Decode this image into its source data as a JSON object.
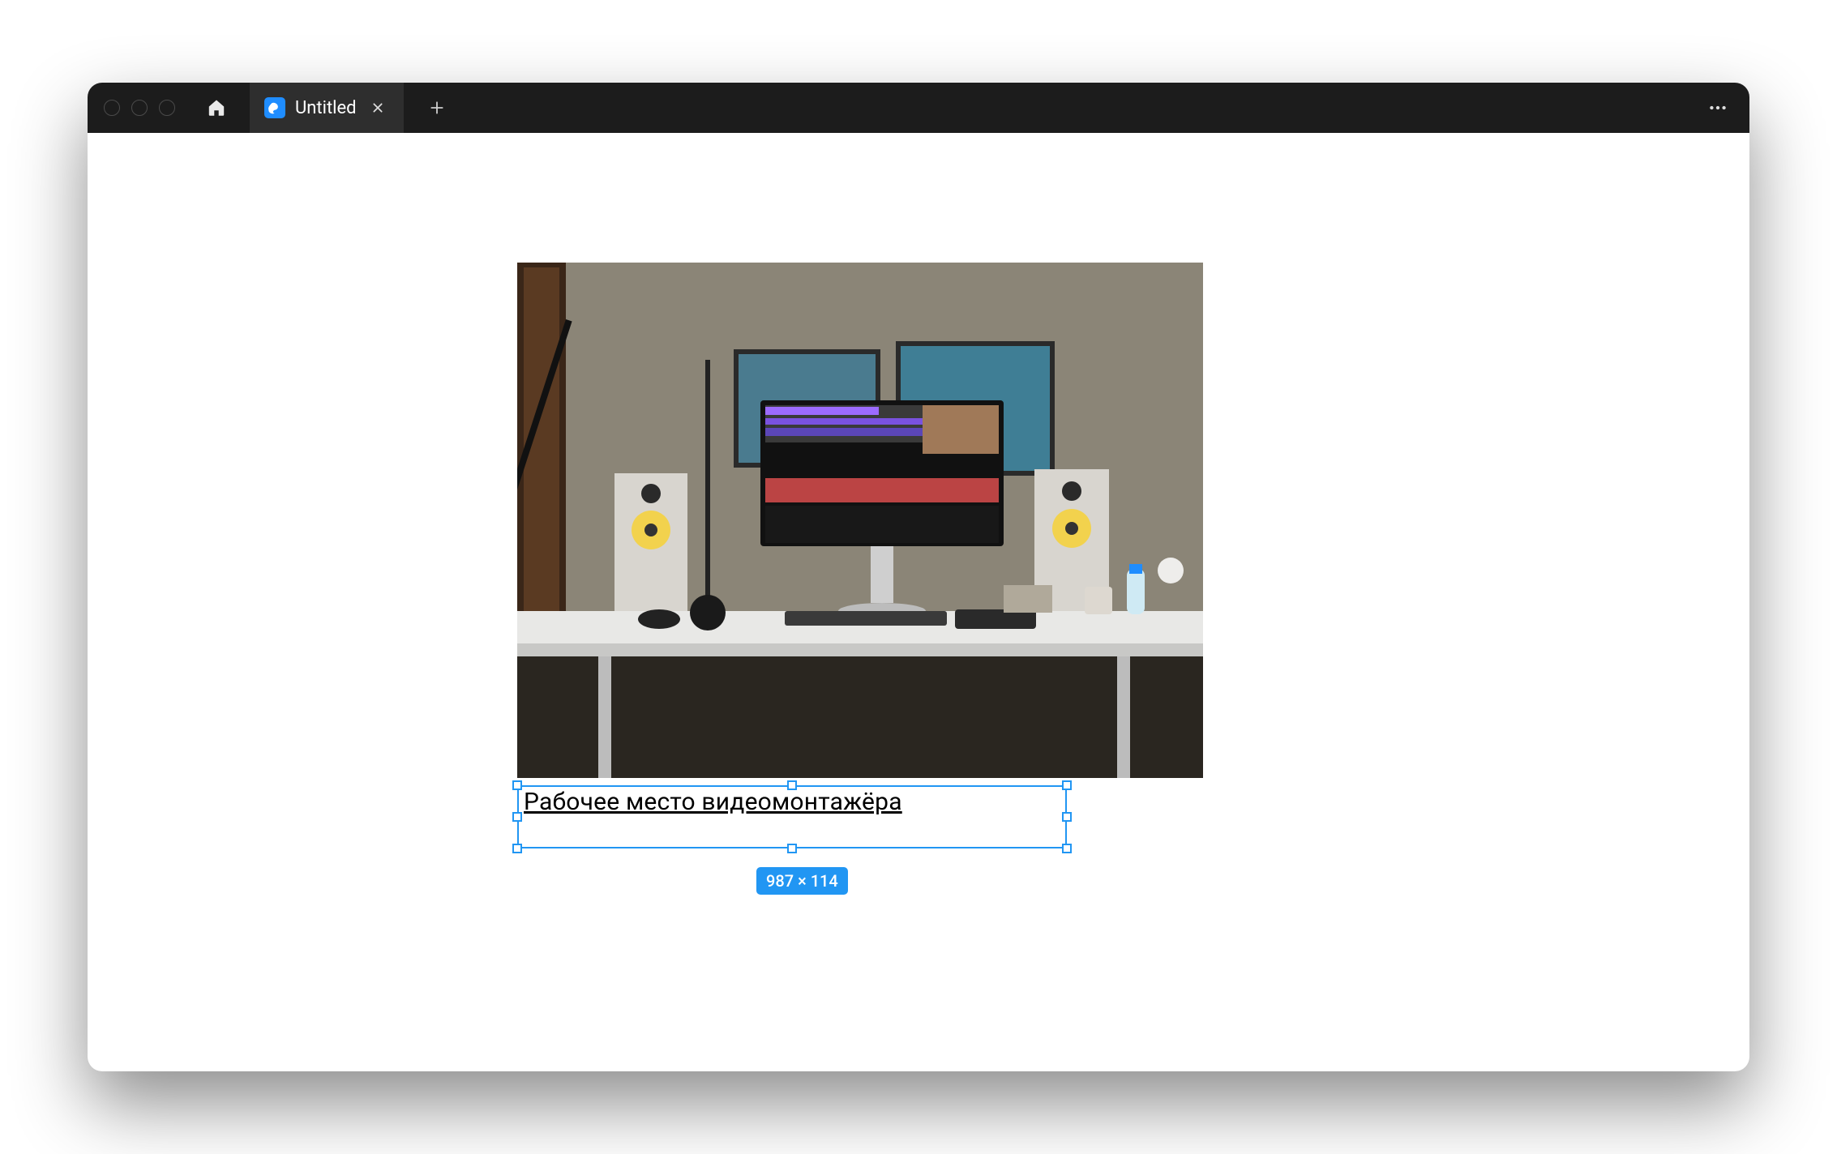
{
  "tabs": [
    {
      "title": "Untitled"
    }
  ],
  "canvas": {
    "image": {
      "alt": "desk-with-monitor-speakers"
    },
    "caption_text": "Рабочее место видеомонтажёра",
    "selection": {
      "dimensions_label": "987 × 114"
    }
  },
  "icons": {
    "home": "home-icon",
    "app": "app-icon",
    "close": "close-icon",
    "new_tab": "plus-icon",
    "more": "more-icon"
  }
}
